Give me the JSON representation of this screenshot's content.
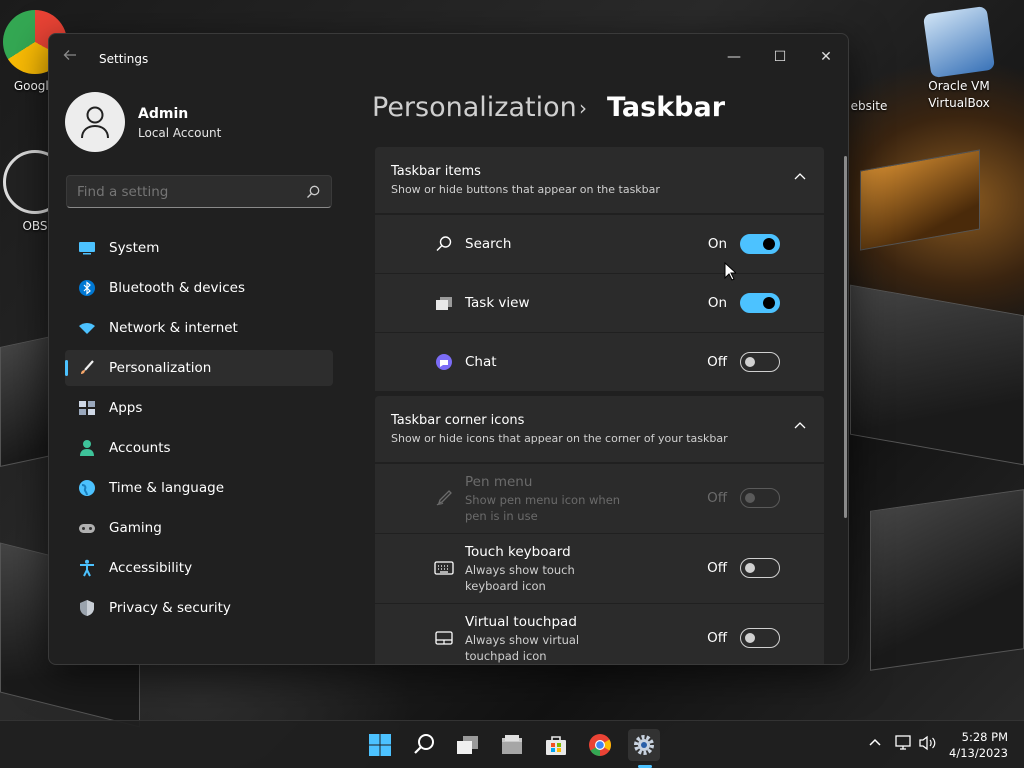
{
  "desktop": {
    "icons": [
      {
        "label": "Google"
      },
      {
        "label": "OBS"
      },
      {
        "label": "ebsite"
      },
      {
        "label": "Oracle VM VirtualBox"
      }
    ]
  },
  "window": {
    "app_title": "Settings",
    "controls": {
      "minimize": "—",
      "maximize": "☐",
      "close": "✕"
    }
  },
  "profile": {
    "name": "Admin",
    "account_type": "Local Account"
  },
  "search": {
    "placeholder": "Find a setting"
  },
  "nav": {
    "items": [
      {
        "label": "System",
        "icon": "system-icon",
        "color": "#4cc2ff"
      },
      {
        "label": "Bluetooth & devices",
        "icon": "bluetooth-icon",
        "color": "#0078d4"
      },
      {
        "label": "Network & internet",
        "icon": "wifi-icon",
        "color": "#4cc2ff"
      },
      {
        "label": "Personalization",
        "icon": "brush-icon",
        "color": "#f7a86b"
      },
      {
        "label": "Apps",
        "icon": "apps-icon",
        "color": "#cfd8e6"
      },
      {
        "label": "Accounts",
        "icon": "accounts-icon",
        "color": "#3ec39a"
      },
      {
        "label": "Time & language",
        "icon": "globe-icon",
        "color": "#4cc2ff"
      },
      {
        "label": "Gaming",
        "icon": "gamepad-icon",
        "color": "#b0b0b0"
      },
      {
        "label": "Accessibility",
        "icon": "accessibility-icon",
        "color": "#4cc2ff"
      },
      {
        "label": "Privacy & security",
        "icon": "shield-icon",
        "color": "#9aa3ad"
      }
    ],
    "active": "Personalization"
  },
  "heading": {
    "breadcrumb": "Personalization",
    "separator": "›",
    "title": "Taskbar"
  },
  "sections": {
    "taskbar_items": {
      "title": "Taskbar items",
      "subtitle": "Show or hide buttons that appear on the taskbar",
      "rows": [
        {
          "label": "Search",
          "state": "On",
          "on": true,
          "icon": "search-icon"
        },
        {
          "label": "Task view",
          "state": "On",
          "on": true,
          "icon": "task-view-icon"
        },
        {
          "label": "Chat",
          "state": "Off",
          "on": false,
          "icon": "chat-icon"
        }
      ]
    },
    "corner_icons": {
      "title": "Taskbar corner icons",
      "subtitle": "Show or hide icons that appear on the corner of your taskbar",
      "rows": [
        {
          "title": "Pen menu",
          "desc": "Show pen menu icon when pen is in use",
          "state": "Off",
          "on": false,
          "disabled": true,
          "icon": "pen-icon"
        },
        {
          "title": "Touch keyboard",
          "desc": "Always show touch keyboard icon",
          "state": "Off",
          "on": false,
          "disabled": false,
          "icon": "keyboard-icon"
        },
        {
          "title": "Virtual touchpad",
          "desc": "Always show virtual touchpad icon",
          "state": "Off",
          "on": false,
          "disabled": false,
          "icon": "touchpad-icon"
        }
      ]
    }
  },
  "taskbar": {
    "apps": [
      "start-icon",
      "search-icon",
      "task-view-icon",
      "file-explorer-icon",
      "store-icon",
      "chrome-icon",
      "settings-icon"
    ],
    "active_app": "settings-icon",
    "clock": {
      "time": "5:28 PM",
      "date": "4/13/2023"
    }
  },
  "colors": {
    "accent": "#4cc2ff",
    "window_bg": "#202020",
    "card_bg": "#2b2b2b"
  }
}
